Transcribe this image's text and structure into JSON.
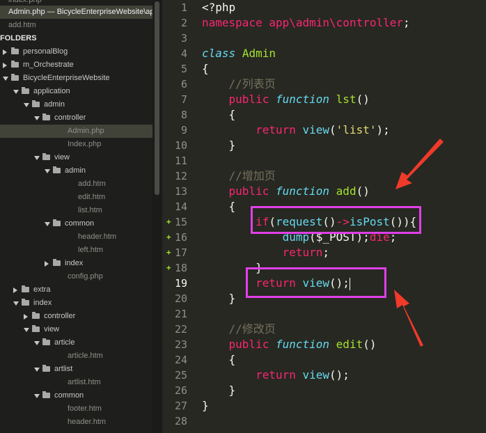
{
  "sidebar": {
    "open_files": [
      {
        "label": "index.php",
        "selected": false
      },
      {
        "label": "Admin.php — BicycleEnterpriseWebsite\\application\\admin\\controller",
        "selected": true
      },
      {
        "label": "add.htm",
        "selected": false
      }
    ],
    "folders_header": "FOLDERS",
    "tree": [
      {
        "label": "personalBlog",
        "depth": 0,
        "type": "folder",
        "expanded": false
      },
      {
        "label": "m_Orchestrate",
        "depth": 0,
        "type": "folder",
        "expanded": false
      },
      {
        "label": "BicycleEnterpriseWebsite",
        "depth": 0,
        "type": "folder",
        "expanded": true
      },
      {
        "label": "application",
        "depth": 1,
        "type": "folder",
        "expanded": true
      },
      {
        "label": "admin",
        "depth": 2,
        "type": "folder",
        "expanded": true
      },
      {
        "label": "controller",
        "depth": 3,
        "type": "folder",
        "expanded": true
      },
      {
        "label": "Admin.php",
        "depth": 4,
        "type": "file",
        "selected": true
      },
      {
        "label": "Index.php",
        "depth": 4,
        "type": "file"
      },
      {
        "label": "view",
        "depth": 3,
        "type": "folder",
        "expanded": true
      },
      {
        "label": "admin",
        "depth": 4,
        "type": "folder",
        "expanded": true
      },
      {
        "label": "add.htm",
        "depth": 5,
        "type": "file"
      },
      {
        "label": "edit.htm",
        "depth": 5,
        "type": "file"
      },
      {
        "label": "list.htm",
        "depth": 5,
        "type": "file"
      },
      {
        "label": "common",
        "depth": 4,
        "type": "folder",
        "expanded": true
      },
      {
        "label": "header.htm",
        "depth": 5,
        "type": "file"
      },
      {
        "label": "left.htm",
        "depth": 5,
        "type": "file"
      },
      {
        "label": "index",
        "depth": 4,
        "type": "folder",
        "expanded": false
      },
      {
        "label": "config.php",
        "depth": 4,
        "type": "file"
      },
      {
        "label": "extra",
        "depth": 1,
        "type": "folder",
        "expanded": false
      },
      {
        "label": "index",
        "depth": 1,
        "type": "folder",
        "expanded": true
      },
      {
        "label": "controller",
        "depth": 2,
        "type": "folder",
        "expanded": false
      },
      {
        "label": "view",
        "depth": 2,
        "type": "folder",
        "expanded": true
      },
      {
        "label": "article",
        "depth": 3,
        "type": "folder",
        "expanded": true
      },
      {
        "label": "article.htm",
        "depth": 4,
        "type": "file"
      },
      {
        "label": "artlist",
        "depth": 3,
        "type": "folder",
        "expanded": true
      },
      {
        "label": "artlist.htm",
        "depth": 4,
        "type": "file"
      },
      {
        "label": "common",
        "depth": 3,
        "type": "folder",
        "expanded": true
      },
      {
        "label": "footer.htm",
        "depth": 4,
        "type": "file"
      },
      {
        "label": "header.htm",
        "depth": 4,
        "type": "file"
      }
    ]
  },
  "editor": {
    "current_line": 19,
    "modified_lines": [
      15,
      16,
      17,
      18
    ],
    "lines": [
      {
        "n": "1",
        "t": [
          [
            "kw",
            ""
          ],
          [
            "",
            "<?php"
          ]
        ]
      },
      {
        "n": "2",
        "t": [
          [
            "kw",
            "namespace"
          ],
          [
            "",
            " "
          ],
          [
            "kw",
            "app\\admin\\controller"
          ],
          [
            "",
            ";"
          ]
        ]
      },
      {
        "n": "3",
        "t": []
      },
      {
        "n": "4",
        "t": [
          [
            "st",
            "class"
          ],
          [
            "",
            " "
          ],
          [
            "fn",
            "Admin"
          ]
        ]
      },
      {
        "n": "5",
        "t": [
          [
            "",
            "{"
          ]
        ]
      },
      {
        "n": "6",
        "t": [
          [
            "",
            "    "
          ],
          [
            "cm",
            "//列表页"
          ]
        ]
      },
      {
        "n": "7",
        "t": [
          [
            "",
            "    "
          ],
          [
            "kw",
            "public"
          ],
          [
            "",
            " "
          ],
          [
            "st",
            "function"
          ],
          [
            "",
            " "
          ],
          [
            "fn",
            "lst"
          ],
          [
            "",
            "()"
          ]
        ]
      },
      {
        "n": "8",
        "t": [
          [
            "",
            "    {"
          ]
        ]
      },
      {
        "n": "9",
        "t": [
          [
            "",
            "        "
          ],
          [
            "kw",
            "return"
          ],
          [
            "",
            " "
          ],
          [
            "bi",
            "view"
          ],
          [
            "",
            "("
          ],
          [
            "str",
            "'list'"
          ],
          [
            "",
            ");"
          ]
        ]
      },
      {
        "n": "10",
        "t": [
          [
            "",
            "    }"
          ]
        ]
      },
      {
        "n": "11",
        "t": []
      },
      {
        "n": "12",
        "t": [
          [
            "",
            "    "
          ],
          [
            "cm",
            "//增加页"
          ]
        ]
      },
      {
        "n": "13",
        "t": [
          [
            "",
            "    "
          ],
          [
            "kw",
            "public"
          ],
          [
            "",
            " "
          ],
          [
            "st",
            "function"
          ],
          [
            "",
            " "
          ],
          [
            "fn",
            "add"
          ],
          [
            "",
            "()"
          ]
        ]
      },
      {
        "n": "14",
        "t": [
          [
            "",
            "    {"
          ]
        ]
      },
      {
        "n": "15",
        "t": [
          [
            "",
            "        "
          ],
          [
            "kw",
            "if"
          ],
          [
            "",
            "("
          ],
          [
            "bi",
            "request"
          ],
          [
            "",
            "()"
          ],
          [
            "kw",
            "->"
          ],
          [
            "bi",
            "isPost"
          ],
          [
            "",
            "()){"
          ]
        ]
      },
      {
        "n": "16",
        "t": [
          [
            "",
            "            "
          ],
          [
            "bi",
            "dump"
          ],
          [
            "",
            "($_POST);"
          ],
          [
            "kw",
            "die"
          ],
          [
            "",
            ";"
          ]
        ]
      },
      {
        "n": "17",
        "t": [
          [
            "",
            "            "
          ],
          [
            "kw",
            "return"
          ],
          [
            "",
            ";"
          ]
        ]
      },
      {
        "n": "18",
        "t": [
          [
            "",
            "        }"
          ]
        ]
      },
      {
        "n": "19",
        "t": [
          [
            "",
            "        "
          ],
          [
            "kw",
            "return"
          ],
          [
            "",
            " "
          ],
          [
            "bi",
            "view"
          ],
          [
            "",
            "();"
          ]
        ]
      },
      {
        "n": "20",
        "t": [
          [
            "",
            "    }"
          ]
        ]
      },
      {
        "n": "21",
        "t": []
      },
      {
        "n": "22",
        "t": [
          [
            "",
            "    "
          ],
          [
            "cm",
            "//修改页"
          ]
        ]
      },
      {
        "n": "23",
        "t": [
          [
            "",
            "    "
          ],
          [
            "kw",
            "public"
          ],
          [
            "",
            " "
          ],
          [
            "st",
            "function"
          ],
          [
            "",
            " "
          ],
          [
            "fn",
            "edit"
          ],
          [
            "",
            "()"
          ]
        ]
      },
      {
        "n": "24",
        "t": [
          [
            "",
            "    {"
          ]
        ]
      },
      {
        "n": "25",
        "t": [
          [
            "",
            "        "
          ],
          [
            "kw",
            "return"
          ],
          [
            "",
            " "
          ],
          [
            "bi",
            "view"
          ],
          [
            "",
            "();"
          ]
        ]
      },
      {
        "n": "26",
        "t": [
          [
            "",
            "    }"
          ]
        ]
      },
      {
        "n": "27",
        "t": [
          [
            "",
            "}"
          ]
        ]
      },
      {
        "n": "28",
        "t": []
      }
    ]
  },
  "annotations": {
    "color": "#e040e8",
    "arrow_color": "#f03a2a"
  },
  "colors": {
    "background": "#272822",
    "sidebar": "#1e1f1c",
    "keyword": "#f92672",
    "storage": "#66d9ef",
    "function_name": "#a6e22e",
    "string": "#e6db74",
    "comment": "#75715e"
  }
}
